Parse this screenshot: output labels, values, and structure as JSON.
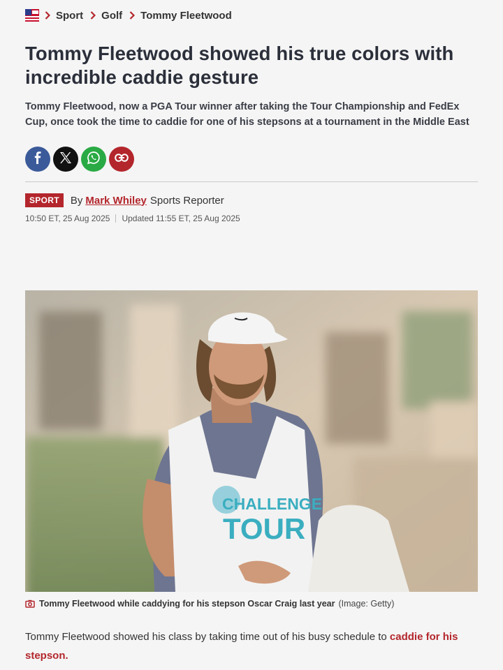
{
  "breadcrumb": {
    "logo_icon": "mirror-us-flag-logo-icon",
    "items": [
      "Sport",
      "Golf",
      "Tommy Fleetwood"
    ],
    "separator_icon": "chevron-right-icon"
  },
  "article": {
    "headline": "Tommy Fleetwood showed his true colors with incredible caddie gesture",
    "standfirst": "Tommy Fleetwood, now a PGA Tour winner after taking the Tour Championship and FedEx Cup, once took the time to caddie for one of his stepsons at a tournament in the Middle East"
  },
  "share": {
    "buttons": [
      {
        "icon": "facebook-icon",
        "color": "#3b5a9a"
      },
      {
        "icon": "x-icon",
        "color": "#111111"
      },
      {
        "icon": "whatsapp-icon",
        "color": "#2aaa44"
      },
      {
        "icon": "link-icon",
        "color": "#b3262c"
      }
    ]
  },
  "byline": {
    "tag": "SPORT",
    "by": "By",
    "author": "Mark Whiley",
    "role": "Sports Reporter",
    "published": "10:50 ET, 25 Aug 2025",
    "updated": "Updated 11:55 ET, 25 Aug 2025"
  },
  "image": {
    "vest_text_line1": "CHALLENGE",
    "vest_text_line2": "TOUR",
    "caption": "Tommy Fleetwood while caddying for his stepson Oscar Craig last year",
    "credit": "(Image: Getty)",
    "caption_icon": "camera-icon"
  },
  "body": {
    "text": "Tommy Fleetwood showed his class by taking time out of his busy schedule to ",
    "link_text": "caddie for his stepson",
    "end": "."
  },
  "colors": {
    "accent": "#b3262c",
    "headline": "#2b2f3a",
    "background": "#f5f5f5"
  }
}
